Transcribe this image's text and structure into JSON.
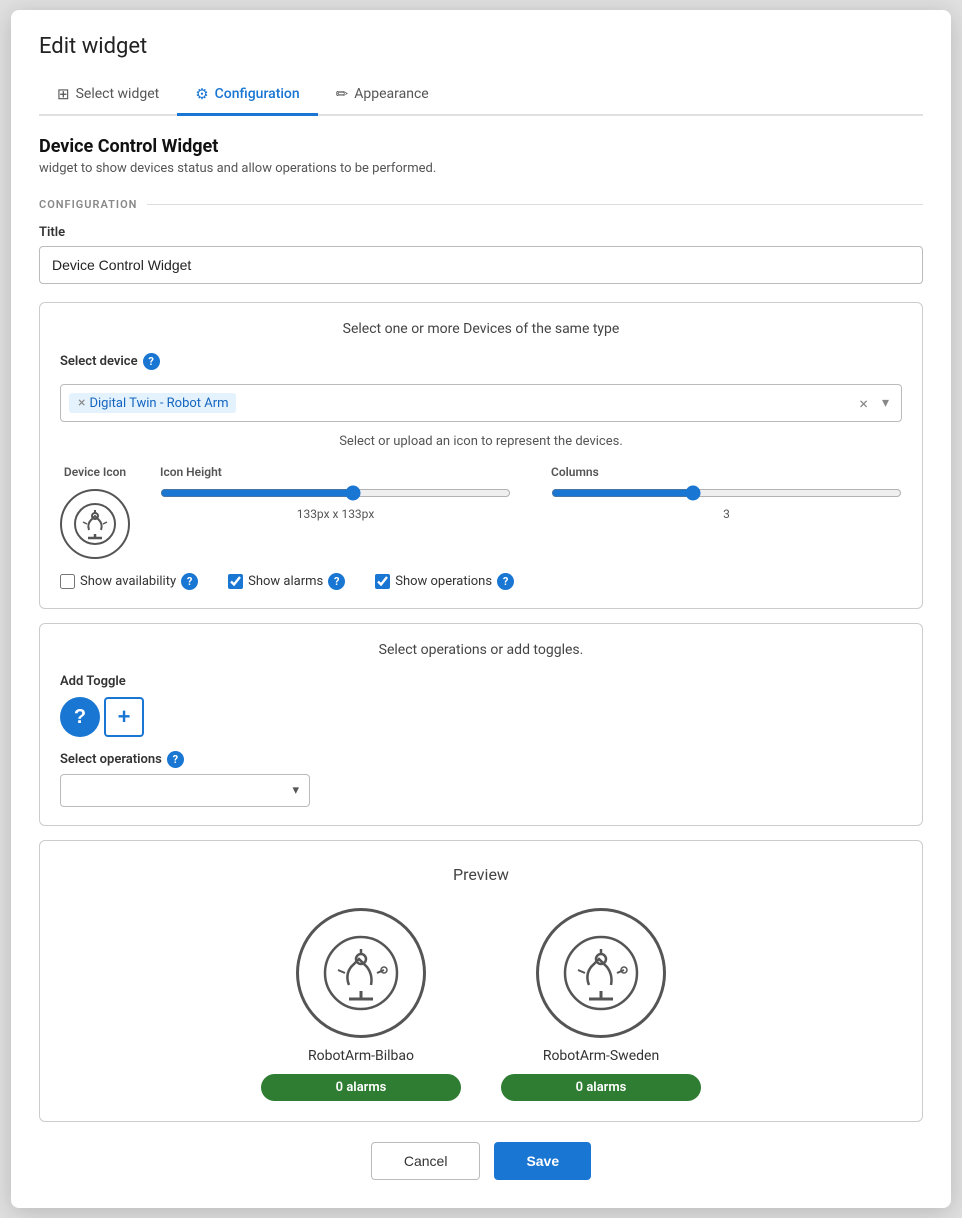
{
  "dialog": {
    "title": "Edit widget"
  },
  "tabs": [
    {
      "id": "select-widget",
      "label": "Select widget",
      "icon": "⊞",
      "active": false
    },
    {
      "id": "configuration",
      "label": "Configuration",
      "icon": "⚙",
      "active": true
    },
    {
      "id": "appearance",
      "label": "Appearance",
      "icon": "✏",
      "active": false
    }
  ],
  "widget": {
    "name": "Device Control Widget",
    "description": "widget to show devices status and allow operations to be performed."
  },
  "configuration": {
    "section_label": "CONFIGURATION",
    "title_field_label": "Title",
    "title_field_value": "Device Control Widget"
  },
  "device_selection": {
    "section_title": "Select one or more Devices of the same type",
    "select_device_label": "Select device",
    "selected_device": "Digital Twin - Robot Arm"
  },
  "icon_section": {
    "title": "Select or upload an icon to represent the devices.",
    "device_icon_label": "Device Icon",
    "icon_height_label": "Icon Height",
    "icon_height_value": "133px x 133px",
    "columns_label": "Columns",
    "columns_value": "3"
  },
  "checkboxes": {
    "show_availability": {
      "label": "Show availability",
      "checked": false
    },
    "show_alarms": {
      "label": "Show alarms",
      "checked": true
    },
    "show_operations": {
      "label": "Show operations",
      "checked": true
    }
  },
  "operations_section": {
    "section_title": "Select operations or add toggles.",
    "add_toggle_label": "Add Toggle",
    "select_operations_label": "Select operations"
  },
  "preview": {
    "title": "Preview",
    "devices": [
      {
        "name": "RobotArm-Bilbao",
        "alarms": "0 alarms"
      },
      {
        "name": "RobotArm-Sweden",
        "alarms": "0 alarms"
      }
    ]
  },
  "footer": {
    "cancel_label": "Cancel",
    "save_label": "Save"
  },
  "colors": {
    "primary": "#1976d2",
    "alarm_green": "#2e7d32"
  }
}
